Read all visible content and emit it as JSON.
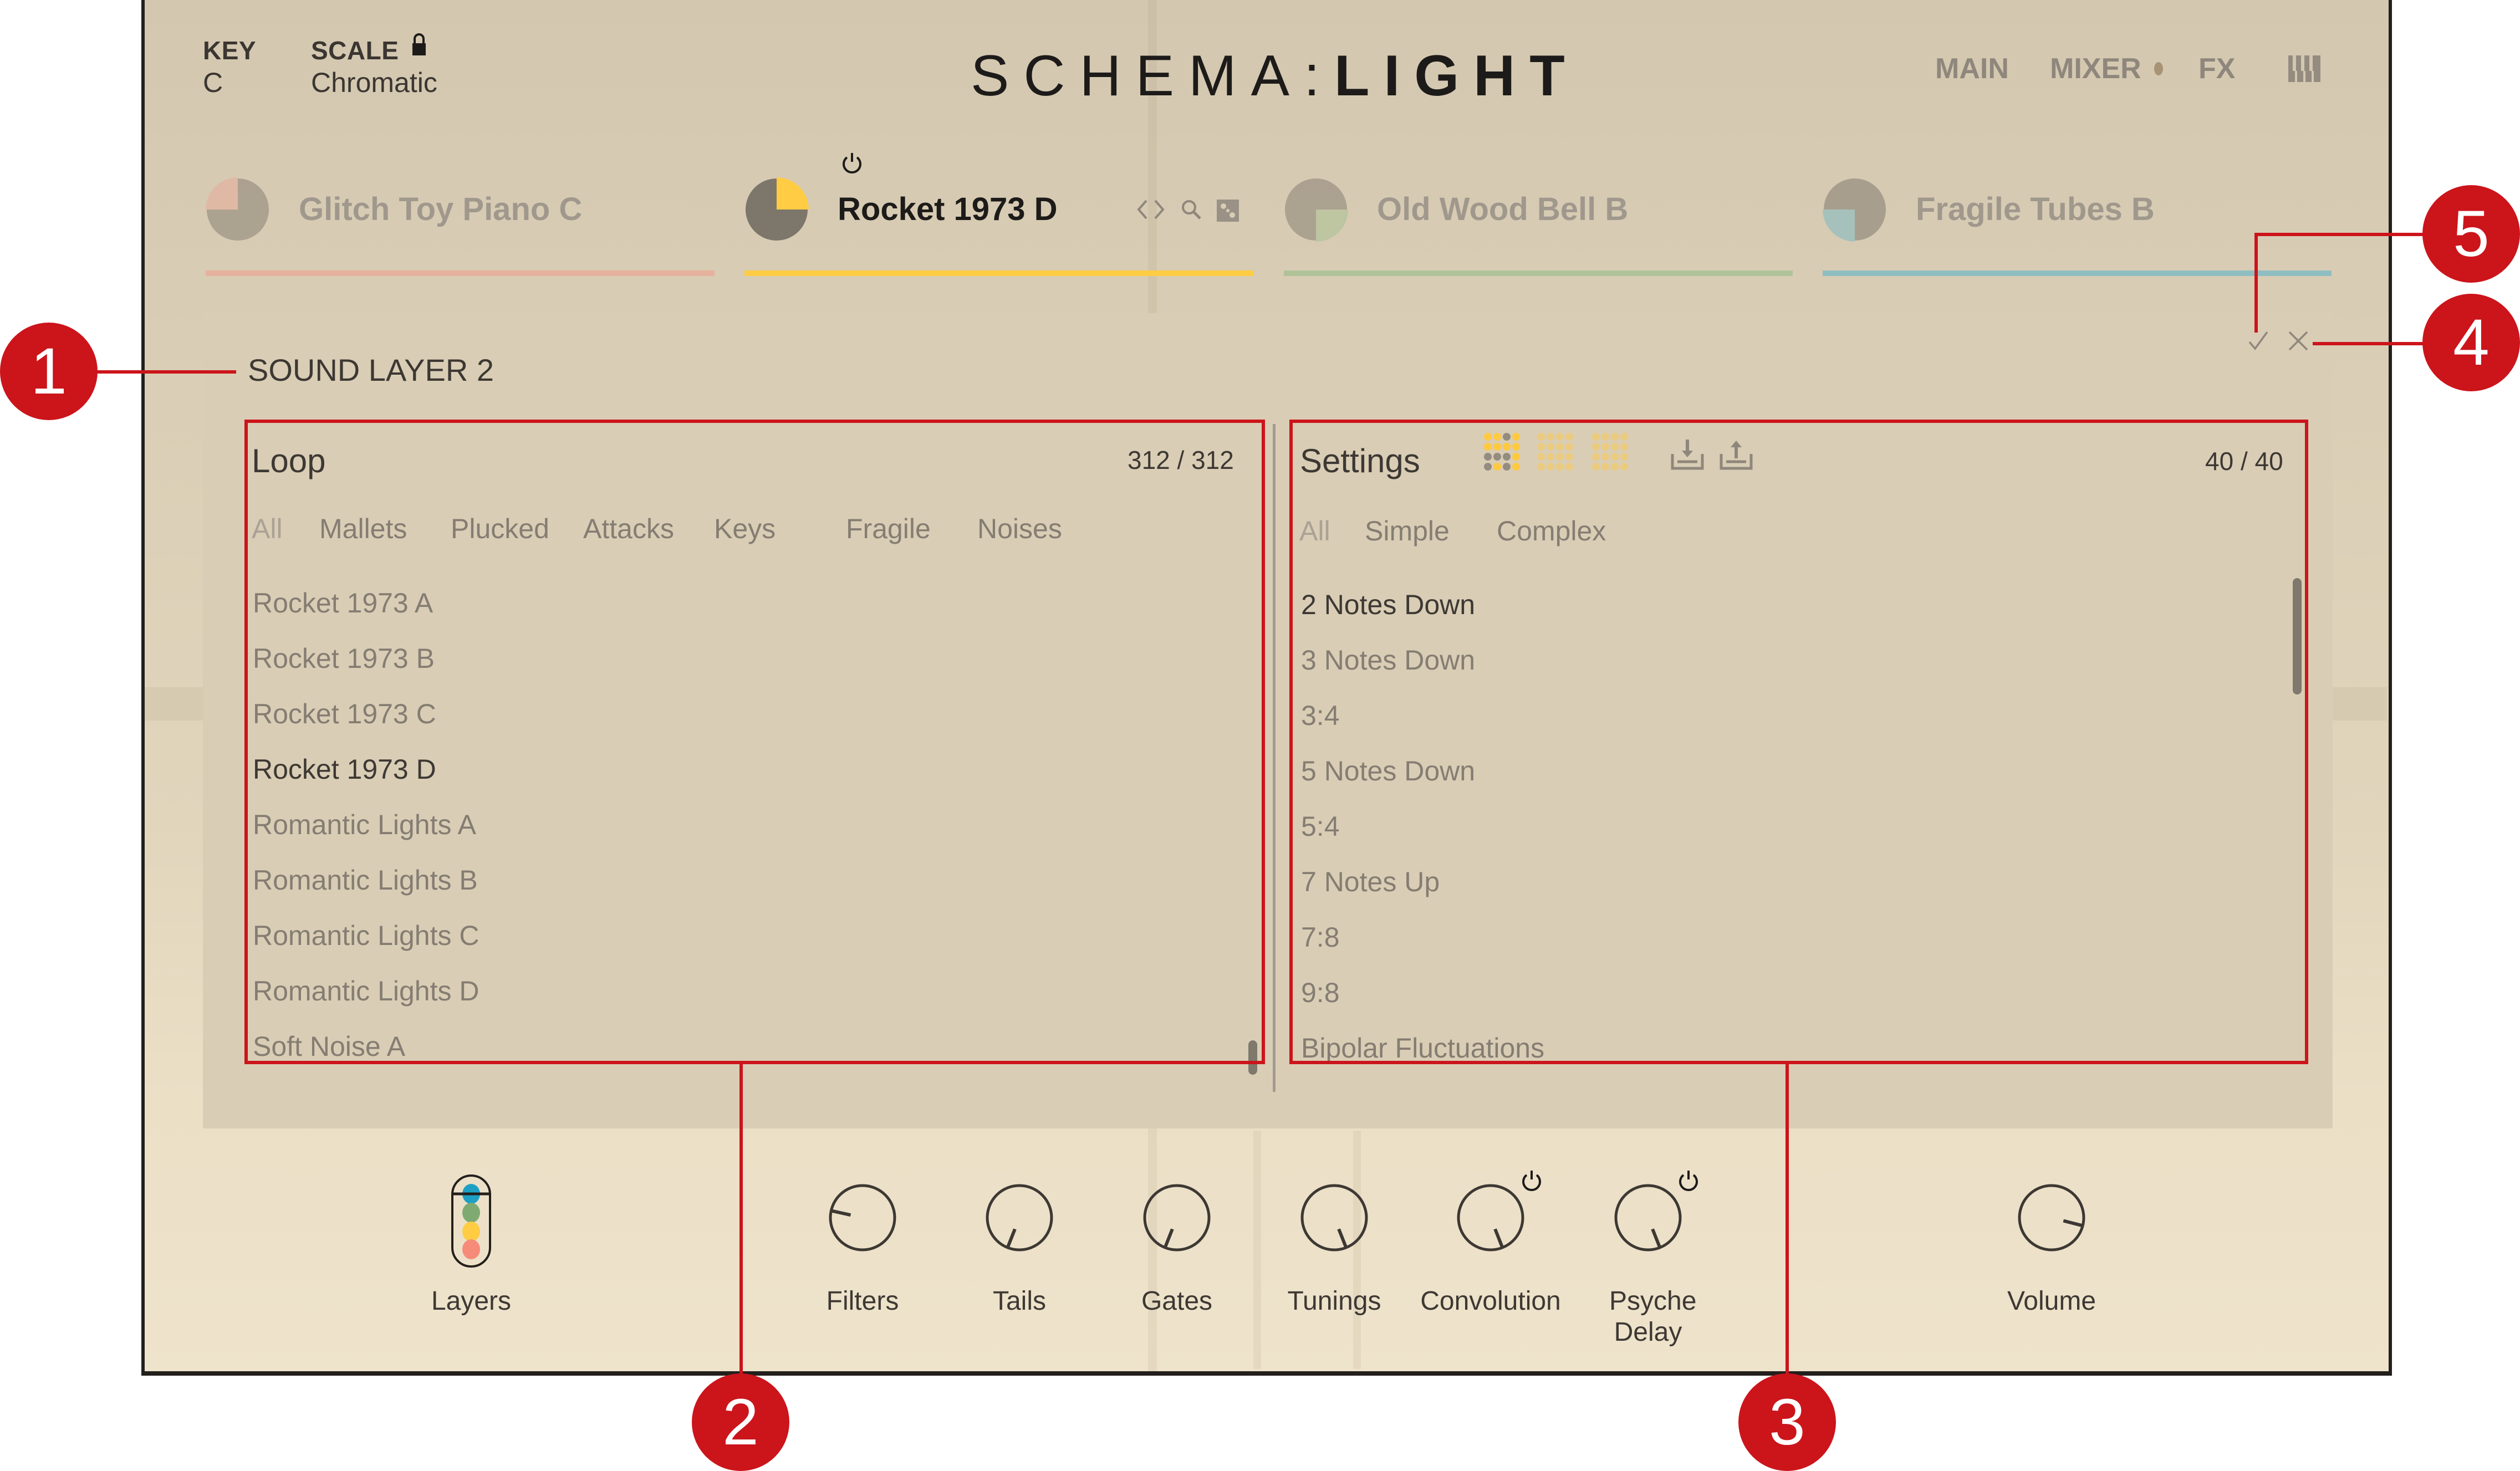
{
  "header": {
    "key_label": "KEY",
    "key_value": "C",
    "scale_label": "SCALE",
    "scale_value": "Chromatic",
    "scale_lock_icon": "lock-icon",
    "logo_left": "SCHEMA:",
    "logo_right": "LIGHT",
    "nav": [
      {
        "label": "MAIN"
      },
      {
        "label": "MIXER"
      },
      {
        "label": "FX"
      }
    ],
    "keyboard_icon": "piano-keys-icon"
  },
  "layers": [
    {
      "name": "Glitch Toy Piano C",
      "color": "#e8ac9a",
      "active": false
    },
    {
      "name": "Rocket 1973 D",
      "color": "#ffcc44",
      "active": true
    },
    {
      "name": "Old Wood Bell B",
      "color": "#a9c193",
      "active": false
    },
    {
      "name": "Fragile Tubes B",
      "color": "#86bcc2",
      "active": false
    }
  ],
  "active_layer_tools": [
    "power-icon",
    "prev-next-icon",
    "search-icon",
    "dice-icon"
  ],
  "overlay": {
    "title": "SOUND LAYER 2",
    "confirm_icon": "checkmark-icon",
    "close_icon": "close-icon",
    "loop": {
      "title": "Loop",
      "count": "312 / 312",
      "filters": [
        "All",
        "Mallets",
        "Plucked",
        "Attacks",
        "Keys",
        "Fragile",
        "Noises"
      ],
      "active_filter": "All",
      "items": [
        "Rocket 1973 A",
        "Rocket 1973 B",
        "Rocket 1973 C",
        "Rocket 1973 D",
        "Romantic Lights A",
        "Romantic Lights B",
        "Romantic Lights C",
        "Romantic Lights D",
        "Soft Noise A"
      ],
      "selected": "Rocket 1973 D"
    },
    "settings": {
      "title": "Settings",
      "count": "40 / 40",
      "filters": [
        "All",
        "Simple",
        "Complex"
      ],
      "active_filter": "All",
      "items": [
        "2 Notes Down",
        "3 Notes Down",
        "3:4",
        "5 Notes Down",
        "5:4",
        "7 Notes Up",
        "7:8",
        "9:8",
        "Bipolar Fluctuations"
      ],
      "selected": "2 Notes Down",
      "tools": [
        "pattern-grid-1-icon",
        "pattern-grid-2-icon",
        "pattern-grid-3-icon",
        "import-icon",
        "export-icon"
      ]
    }
  },
  "controls": [
    {
      "label": "Layers",
      "type": "layers"
    },
    {
      "label": "Filters",
      "type": "knob",
      "value": 0.12
    },
    {
      "label": "Tails",
      "type": "knob",
      "value": 0.42
    },
    {
      "label": "Gates",
      "type": "knob",
      "value": 0.42
    },
    {
      "label": "Tunings",
      "type": "knob",
      "value": 0.58
    },
    {
      "label": "Convolution",
      "type": "knob",
      "value": 0.58,
      "power": true
    },
    {
      "label": "Psyche Delay",
      "type": "knob",
      "value": 0.58,
      "power": true
    },
    {
      "label": "Volume",
      "type": "knob",
      "value": 0.78
    }
  ],
  "layer_colors": [
    "#1ea0c4",
    "#7fab72",
    "#ffcc44",
    "#f58b78"
  ],
  "callouts": [
    "1",
    "2",
    "3",
    "4",
    "5"
  ],
  "colors": {
    "callout": "#cc141b",
    "panel_bg": "#d9cdb5",
    "text_dark": "#3d3833",
    "text_muted": "#857d72"
  }
}
